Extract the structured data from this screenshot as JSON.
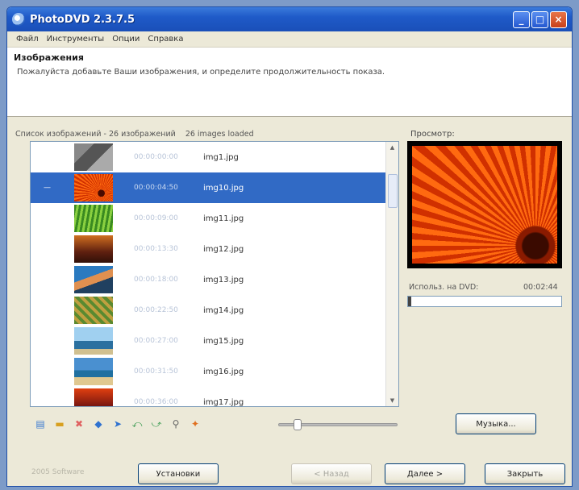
{
  "window": {
    "title": "PhotoDVD 2.3.7.5"
  },
  "menu": [
    "Файл",
    "Инструменты",
    "Опции",
    "Справка"
  ],
  "header": {
    "title": "Изображения",
    "description": "Пожалуйста добавьте Ваши изображения, и определите продолжительность показа."
  },
  "list": {
    "caption_left": "Список изображений - 26 изображений",
    "caption_right": "26 images loaded",
    "items": [
      {
        "duration": "00:00:00:00",
        "filename": "img1.jpg",
        "mark": ""
      },
      {
        "duration": "00:00:04:50",
        "filename": "img10.jpg",
        "mark": "—"
      },
      {
        "duration": "00:00:09:00",
        "filename": "img11.jpg",
        "mark": ""
      },
      {
        "duration": "00:00:13:30",
        "filename": "img12.jpg",
        "mark": ""
      },
      {
        "duration": "00:00:18:00",
        "filename": "img13.jpg",
        "mark": ""
      },
      {
        "duration": "00:00:22:50",
        "filename": "img14.jpg",
        "mark": ""
      },
      {
        "duration": "00:00:27:00",
        "filename": "img15.jpg",
        "mark": ""
      },
      {
        "duration": "00:00:31:50",
        "filename": "img16.jpg",
        "mark": ""
      },
      {
        "duration": "00:00:36:00",
        "filename": "img17.jpg",
        "mark": ""
      }
    ],
    "selected_index": 1
  },
  "preview": {
    "label": "Просмотр:",
    "used_label": "Использ. на DVD:",
    "used_value": "00:02:44",
    "usage_fraction": 0.02
  },
  "toolbar": {
    "icons": [
      "add-image-icon",
      "add-folder-icon",
      "delete-icon",
      "move-up-icon",
      "move-down-icon",
      "rotate-left-icon",
      "rotate-right-icon",
      "zoom-icon",
      "effects-icon"
    ],
    "slider_value": 0.12,
    "music_button": "Музыка..."
  },
  "footer": {
    "brand": "2005 Software",
    "settings_button": "Установки",
    "back_button": "< Назад",
    "next_button": "Далее >",
    "close_button": "Закрыть"
  }
}
